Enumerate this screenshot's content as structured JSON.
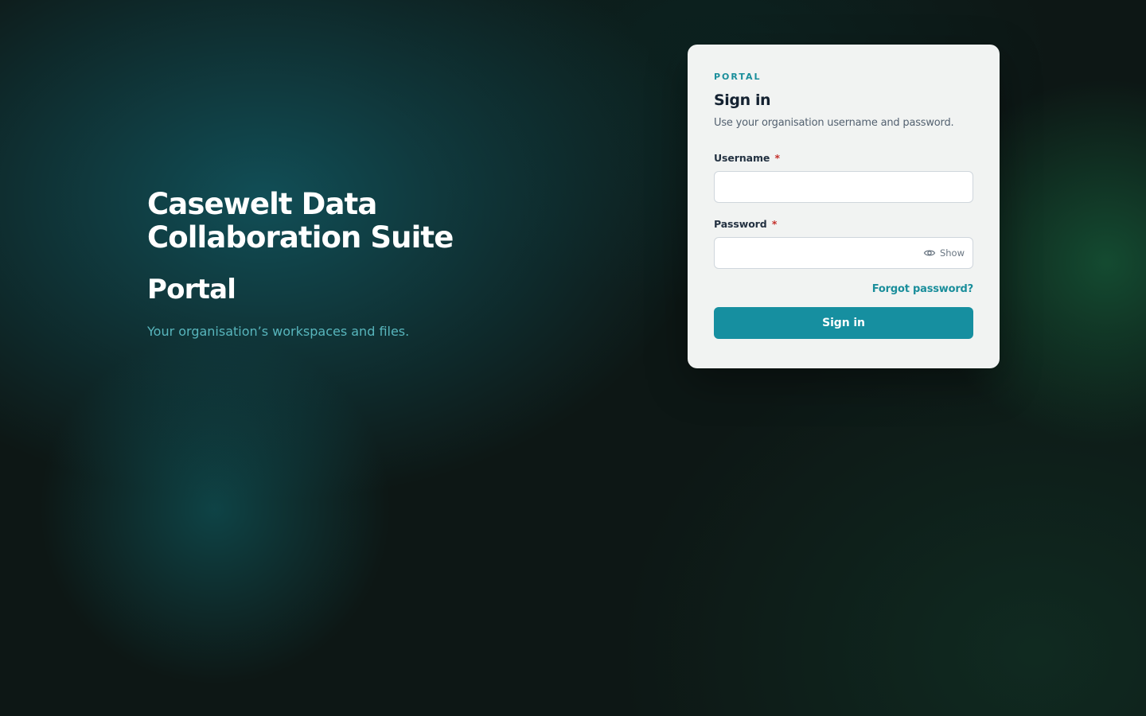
{
  "hero": {
    "title": "Casewelt Data Collaboration Suite",
    "subtitle": "Portal",
    "tagline": "Your organisation’s workspaces and files."
  },
  "card": {
    "eyebrow": "PORTAL",
    "title": "Sign in",
    "description": "Use your organisation username and password.",
    "username": {
      "label": "Username",
      "required_marker": "*",
      "value": ""
    },
    "password": {
      "label": "Password",
      "required_marker": "*",
      "value": "",
      "toggle_label": "Show",
      "toggle_icon": "eye-icon"
    },
    "forgot_link": "Forgot password?",
    "submit_label": "Sign in"
  },
  "colors": {
    "accent": "#168fa0",
    "link": "#1a8e9b",
    "required": "#c4302b",
    "card_background": "#f1f3f2",
    "page_background": "#0d1715"
  }
}
